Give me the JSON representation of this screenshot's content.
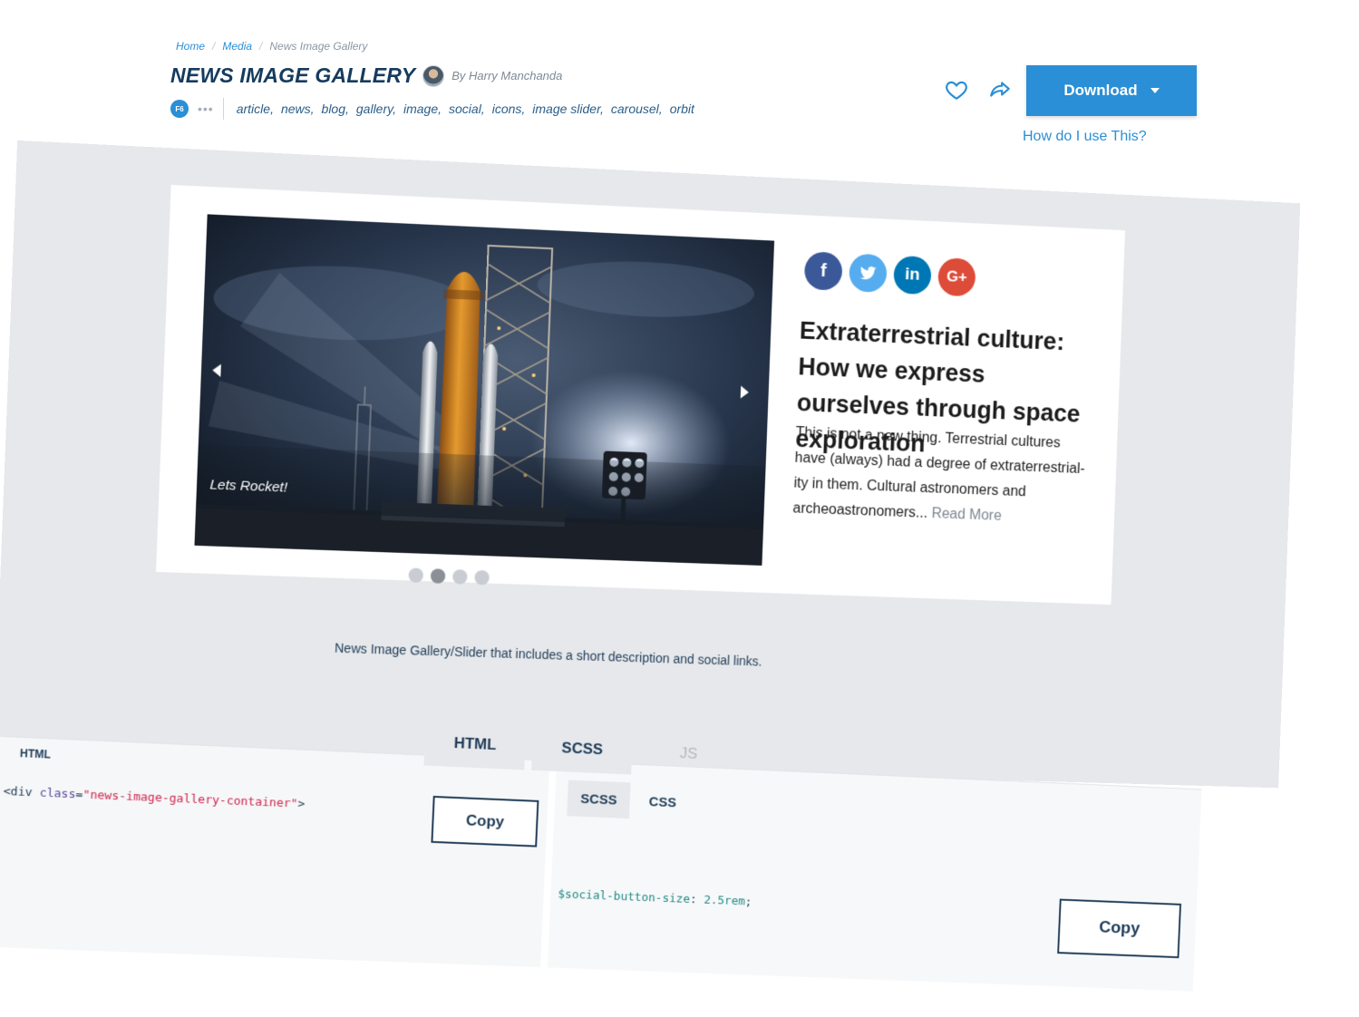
{
  "breadcrumb": [
    "Home",
    "Media",
    "News Image Gallery"
  ],
  "page_title": "NEWS IMAGE GALLERY",
  "author": "By Harry Manchanda",
  "badge": "F6",
  "more": "•••",
  "tags": [
    "article,",
    "news,",
    "blog,",
    "gallery,",
    "image,",
    "social,",
    "icons,",
    "image slider,",
    "carousel,",
    "orbit"
  ],
  "download_label": "Download",
  "howto_label": "How do I use This?",
  "slide_caption": "Lets Rocket!",
  "social": {
    "facebook": "f",
    "twitter": "t",
    "linkedin": "in",
    "googleplus": "G+"
  },
  "article": {
    "title": "Extraterrestrial culture: How we express ourselves through space exploration",
    "body": "This is not a new thing. Terrestrial cultures have (always) had a degree of extraterrestrial-ity in them. Cultural astronomers and archeoastronomers... ",
    "read_more": "Read More"
  },
  "gallery_description": "News Image Gallery/Slider that includes a short description and social links.",
  "code_tabs": [
    "HTML",
    "SCSS",
    "JS"
  ],
  "html_panel": {
    "label": "HTML",
    "copy": "Copy",
    "code": {
      "tag_open": "<div",
      "attr": " class",
      "eq": "=",
      "value": "\"news-image-gallery-container\"",
      "tag_close": ">"
    }
  },
  "scss_panel": {
    "subtabs": [
      "SCSS",
      "CSS"
    ],
    "copy": "Copy",
    "code": {
      "var": "$social-button-size",
      "colon": ": ",
      "value": "2.5rem",
      "semi": ";"
    }
  },
  "colors": {
    "accent": "#2a8fd6",
    "title": "#163b5e",
    "facebook": "#3b5998",
    "twitter": "#55acee",
    "linkedin": "#0077b5",
    "googleplus": "#dd4b39"
  },
  "slider": {
    "dots": 4,
    "active_index": 1
  }
}
